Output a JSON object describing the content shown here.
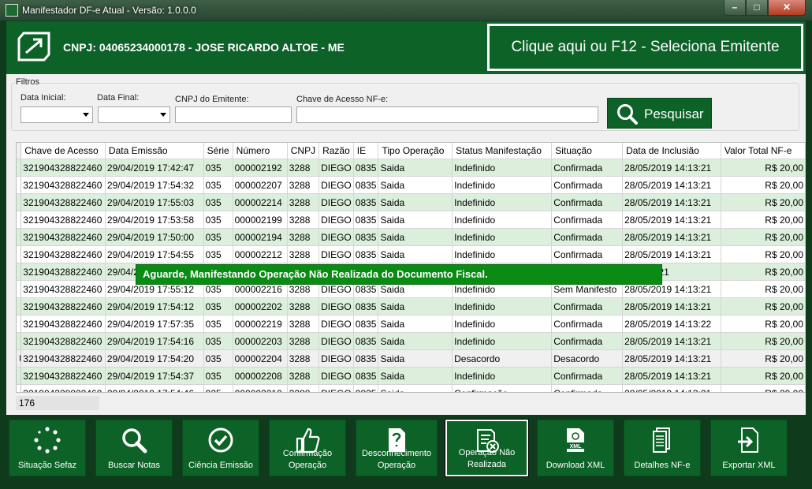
{
  "window": {
    "title": "Manifestador DF-e Atual - Versão: 1.0.0.0"
  },
  "header": {
    "cnpj_label": "CNPJ: 04065234000178 - JOSE RICARDO ALTOE - ME",
    "select_emitente": "Clique aqui ou F12 - Seleciona Emitente"
  },
  "filters": {
    "legend": "Filtros",
    "data_inicial": "Data Inicial:",
    "data_final": "Data Final:",
    "cnpj_emitente": "CNPJ do Emitente:",
    "chave_acesso": "Chave de Acesso NF-e:",
    "search_button": "Pesquisar"
  },
  "grid": {
    "columns": [
      "Chave de Acesso",
      "Data Emissão",
      "Série",
      "Número",
      "CNPJ",
      "Razão",
      "IE",
      "Tipo Operação",
      "Status Manifestação",
      "Situação",
      "Data de Inclusião",
      "Valor Total NF-e"
    ],
    "rows": [
      [
        "321904328822460",
        "29/04/2019 17:42:47",
        "035",
        "000002192",
        "3288",
        "DIEGO",
        "0835",
        "Saida",
        "Indefinido",
        "Confirmada",
        "28/05/2019 14:13:21",
        "R$ 20,00"
      ],
      [
        "321904328822460",
        "29/04/2019 17:54:32",
        "035",
        "000002207",
        "3288",
        "DIEGO",
        "0835",
        "Saida",
        "Indefinido",
        "Confirmada",
        "28/05/2019 14:13:21",
        "R$ 20,00"
      ],
      [
        "321904328822460",
        "29/04/2019 17:55:03",
        "035",
        "000002214",
        "3288",
        "DIEGO",
        "0835",
        "Saida",
        "Indefinido",
        "Confirmada",
        "28/05/2019 14:13:21",
        "R$ 20,00"
      ],
      [
        "321904328822460",
        "29/04/2019 17:53:58",
        "035",
        "000002199",
        "3288",
        "DIEGO",
        "0835",
        "Saida",
        "Indefinido",
        "Confirmada",
        "28/05/2019 14:13:21",
        "R$ 20,00"
      ],
      [
        "321904328822460",
        "29/04/2019 17:50:00",
        "035",
        "000002194",
        "3288",
        "DIEGO",
        "0835",
        "Saida",
        "Indefinido",
        "Confirmada",
        "28/05/2019 14:13:21",
        "R$ 20,00"
      ],
      [
        "321904328822460",
        "29/04/2019 17:54:55",
        "035",
        "000002212",
        "3288",
        "DIEGO",
        "0835",
        "Saida",
        "Indefinido",
        "Confirmada",
        "28/05/2019 14:13:21",
        "R$ 20,00"
      ],
      [
        "321904328822460",
        "29/04/2",
        "",
        "",
        "",
        "",
        "",
        "",
        "",
        "",
        "9 14:13:21",
        "R$ 20,00"
      ],
      [
        "321904328822460",
        "29/04/2019 17:55:12",
        "035",
        "000002216",
        "3288",
        "DIEGO",
        "0835",
        "Saida",
        "Indefinido",
        "Sem Manifesto",
        "28/05/2019 14:13:21",
        "R$ 20,00"
      ],
      [
        "321904328822460",
        "29/04/2019 17:54:12",
        "035",
        "000002202",
        "3288",
        "DIEGO",
        "0835",
        "Saida",
        "Indefinido",
        "Confirmada",
        "28/05/2019 14:13:21",
        "R$ 20,00"
      ],
      [
        "321904328822460",
        "29/04/2019 17:57:35",
        "035",
        "000002219",
        "3288",
        "DIEGO",
        "0835",
        "Saida",
        "Indefinido",
        "Confirmada",
        "28/05/2019 14:13:22",
        "R$ 20,00"
      ],
      [
        "321904328822460",
        "29/04/2019 17:54:16",
        "035",
        "000002203",
        "3288",
        "DIEGO",
        "0835",
        "Saida",
        "Indefinido",
        "Confirmada",
        "28/05/2019 14:13:21",
        "R$ 20,00"
      ],
      [
        "321904328822460",
        "29/04/2019 17:54:20",
        "035",
        "000002204",
        "3288",
        "DIEGO",
        "0835",
        "Saida",
        "Desacordo",
        "Desacordo",
        "28/05/2019 14:13:21",
        "R$ 20,00"
      ],
      [
        "321904328822460",
        "29/04/2019 17:54:37",
        "035",
        "000002208",
        "3288",
        "DIEGO",
        "0835",
        "Saida",
        "Indefinido",
        "Confirmada",
        "28/05/2019 14:13:21",
        "R$ 20,00"
      ],
      [
        "321904328822460",
        "29/04/2019 17:54:46",
        "035",
        "000002210",
        "3288",
        "DIEGO",
        "0835",
        "Saida",
        "Confirmação",
        "Confirmada",
        "28/05/2019 14:13:21",
        "R$ 20,00"
      ]
    ],
    "current_row": 11
  },
  "status": {
    "count": "176"
  },
  "toast": {
    "message": "Aguarde, Manifestando Operação Não Realizada do Documento Fiscal."
  },
  "actions": [
    {
      "label": "Situação Sefaz",
      "icon": "spinner-icon"
    },
    {
      "label": "Buscar Notas",
      "icon": "search-icon"
    },
    {
      "label": "Ciência Emissão",
      "icon": "check-circle-icon"
    },
    {
      "label": "Confirmação Operação",
      "icon": "thumbs-up-icon"
    },
    {
      "label": "Desconhecimento Operação",
      "icon": "question-document-icon"
    },
    {
      "label": "Operação Não Realizada",
      "icon": "cancel-document-icon"
    },
    {
      "label": "Download XML",
      "icon": "xml-file-icon"
    },
    {
      "label": "Detalhes NF-e",
      "icon": "documents-icon"
    },
    {
      "label": "Exportar XML",
      "icon": "export-icon"
    }
  ],
  "selected_action": 5,
  "colors": {
    "brand_green": "#0d6227",
    "toast_green": "#098b14",
    "row_alt": "#dcefdc"
  }
}
